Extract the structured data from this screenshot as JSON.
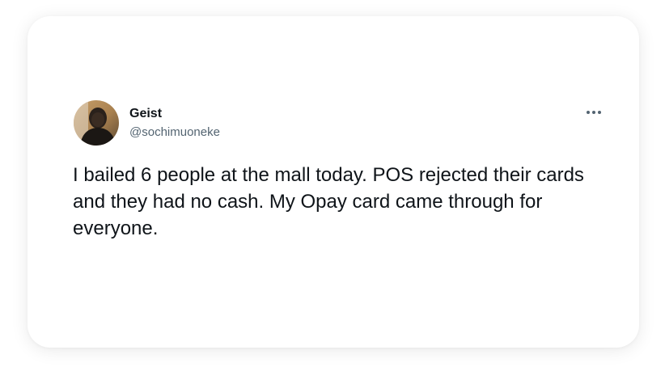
{
  "tweet": {
    "author": {
      "display_name": "Geist",
      "handle": "@sochimuoneke",
      "avatar_icon": "profile-photo"
    },
    "more_icon": "ellipsis-horizontal-icon",
    "text": "I bailed 6 people at the mall today. POS rejected their cards and they had no cash. My Opay card came through for everyone."
  },
  "colors": {
    "text_primary": "#0f1419",
    "text_secondary": "#536471",
    "card_background": "#ffffff"
  }
}
